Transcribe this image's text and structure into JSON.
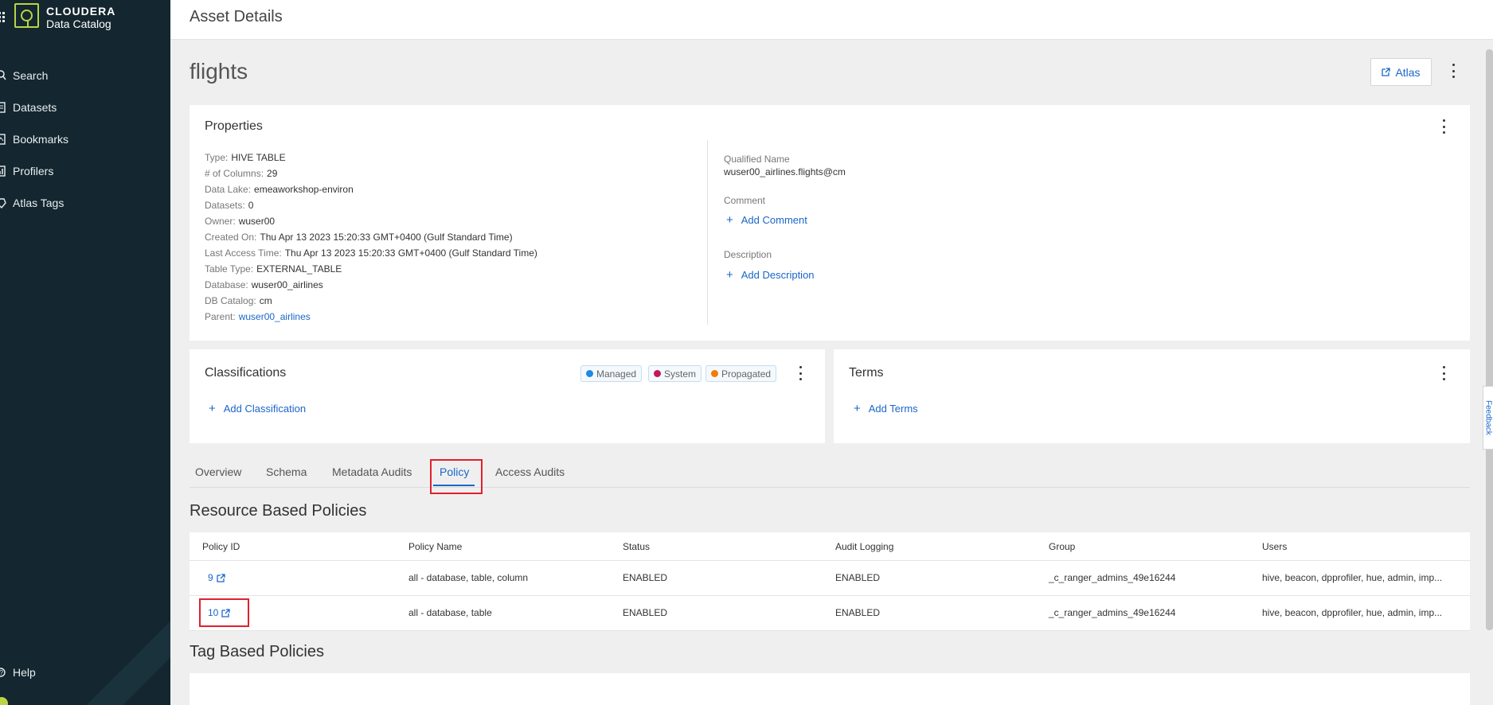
{
  "brand": {
    "name": "CLOUDERA",
    "product": "Data Catalog"
  },
  "nav": {
    "items": [
      {
        "label": "Search",
        "icon": "search-icon"
      },
      {
        "label": "Datasets",
        "icon": "datasets-icon"
      },
      {
        "label": "Bookmarks",
        "icon": "bookmark-icon"
      },
      {
        "label": "Profilers",
        "icon": "profilers-icon"
      },
      {
        "label": "Atlas Tags",
        "icon": "tag-icon"
      }
    ],
    "help": "Help"
  },
  "header": {
    "title": "Asset Details"
  },
  "asset": {
    "name": "flights",
    "atlas_button": "Atlas"
  },
  "properties": {
    "title": "Properties",
    "rows": [
      {
        "k": "Type:",
        "v": "HIVE TABLE"
      },
      {
        "k": "# of Columns:",
        "v": "29"
      },
      {
        "k": "Data Lake:",
        "v": "emeaworkshop-environ"
      },
      {
        "k": "Datasets:",
        "v": "0"
      },
      {
        "k": "Owner:",
        "v": "wuser00"
      },
      {
        "k": "Created On:",
        "v": "Thu Apr 13 2023 15:20:33 GMT+0400 (Gulf Standard Time)"
      },
      {
        "k": "Last Access Time:",
        "v": "Thu Apr 13 2023 15:20:33 GMT+0400 (Gulf Standard Time)"
      },
      {
        "k": "Table Type:",
        "v": "EXTERNAL_TABLE"
      },
      {
        "k": "Database:",
        "v": "wuser00_airlines"
      },
      {
        "k": "DB Catalog:",
        "v": "cm"
      }
    ],
    "parent_label": "Parent:",
    "parent_value": "wuser00_airlines",
    "qualified_name_label": "Qualified Name",
    "qualified_name": "wuser00_airlines.flights@cm",
    "comment_label": "Comment",
    "add_comment": "Add Comment",
    "description_label": "Description",
    "add_description": "Add Description"
  },
  "classifications": {
    "title": "Classifications",
    "chips": [
      {
        "label": "Managed",
        "color": "#1e88e5"
      },
      {
        "label": "System",
        "color": "#c2185b"
      },
      {
        "label": "Propagated",
        "color": "#f57c00"
      }
    ],
    "add": "Add Classification"
  },
  "terms": {
    "title": "Terms",
    "add": "Add Terms"
  },
  "tabs": [
    "Overview",
    "Schema",
    "Metadata Audits",
    "Policy",
    "Access Audits"
  ],
  "resource_policies": {
    "title": "Resource Based Policies",
    "columns": [
      "Policy ID",
      "Policy Name",
      "Status",
      "Audit Logging",
      "Group",
      "Users"
    ],
    "rows": [
      {
        "id": "9",
        "name": "all - database, table, column",
        "status": "ENABLED",
        "audit": "ENABLED",
        "group": "_c_ranger_admins_49e16244",
        "users": "hive, beacon, dpprofiler, hue, admin, imp..."
      },
      {
        "id": "10",
        "name": "all - database, table",
        "status": "ENABLED",
        "audit": "ENABLED",
        "group": "_c_ranger_admins_49e16244",
        "users": "hive, beacon, dpprofiler, hue, admin, imp..."
      }
    ]
  },
  "tag_policies": {
    "title": "Tag Based Policies"
  },
  "feedback": "Feedback"
}
